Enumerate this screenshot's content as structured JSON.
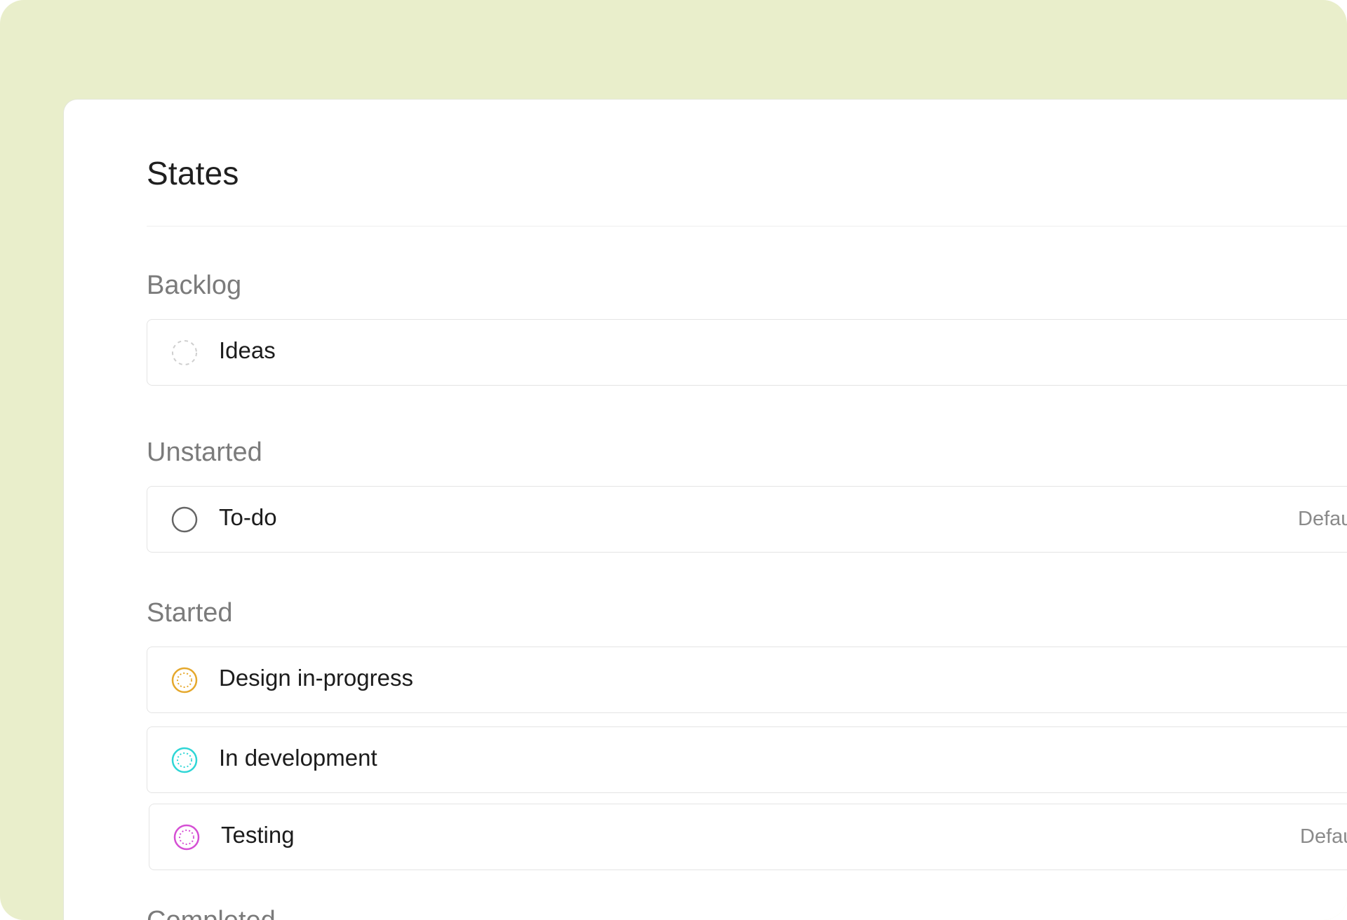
{
  "header": {
    "title": "States"
  },
  "groups": [
    {
      "title": "Backlog",
      "states": [
        {
          "label": "Ideas",
          "icon": "dashed-circle-icon",
          "color": "#cfcfcf",
          "default_label": ""
        }
      ]
    },
    {
      "title": "Unstarted",
      "states": [
        {
          "label": "To-do",
          "icon": "empty-circle-icon",
          "color": "#666666",
          "default_label": "Defau"
        }
      ]
    },
    {
      "title": "Started",
      "states": [
        {
          "label": "Design in-progress",
          "icon": "dotted-circle-icon",
          "color": "#e5a82c",
          "default_label": ""
        },
        {
          "label": "In development",
          "icon": "dotted-circle-icon",
          "color": "#2fd6d6",
          "default_label": ""
        },
        {
          "label": "Testing",
          "icon": "dotted-circle-icon",
          "color": "#d54fd4",
          "default_label": "Defau"
        }
      ]
    },
    {
      "title": "Completed",
      "states": []
    }
  ]
}
